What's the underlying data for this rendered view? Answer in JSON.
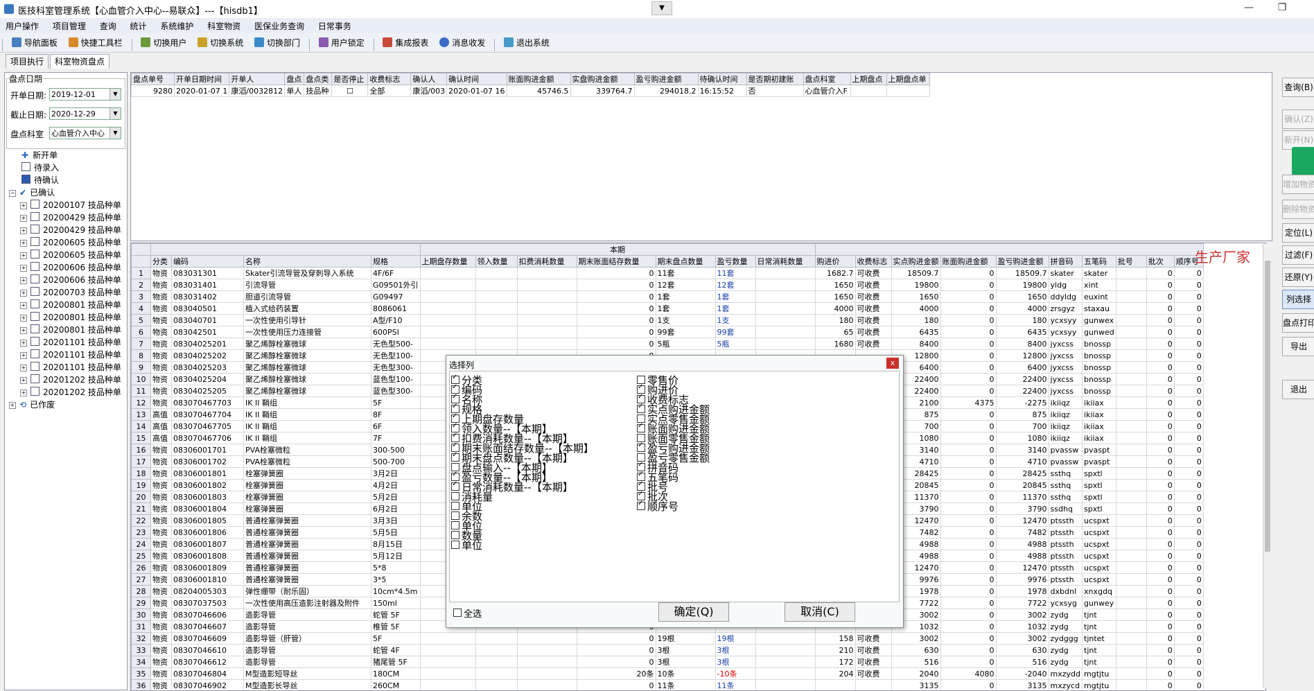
{
  "window": {
    "title": "医技科室管理系统【心血管介入中心--易联众】---【hisdb1】",
    "minimize": "—",
    "restore": "❐",
    "close": "✕"
  },
  "menu": [
    "用户操作",
    "项目管理",
    "查询",
    "统计",
    "系统维护",
    "科室物资",
    "医保业务查询",
    "日常事务"
  ],
  "toolbar": [
    "导航面板",
    "快捷工具栏",
    "切换用户",
    "切换系统",
    "切换部门",
    "用户锁定",
    "集成报表",
    "消息收发",
    "退出系统"
  ],
  "tabs": [
    "项目执行",
    "科室物资盘点"
  ],
  "left": {
    "group_title": "盘点日期",
    "start_label": "开单日期:",
    "start_value": "2019-12-01",
    "end_label": "截止日期:",
    "end_value": "2020-12-29",
    "dept_label": "盘点科室",
    "dept_value": "心血管介入中心",
    "tree": {
      "new": "新开单",
      "pending_entry": "待录入",
      "pending_confirm": "待确认",
      "confirmed": "已确认",
      "voided": "已作废",
      "children": [
        "20200107 技品种单",
        "20200429 技品种单",
        "20200429 技品种单",
        "20200605 技品种单",
        "20200605 技品种单",
        "20200606 技品种单",
        "20200606 技品种单",
        "20200703 技品种单",
        "20200801 技品种单",
        "20200801 技品种单",
        "20200801 技品种单",
        "20201101 技品种单",
        "20201101 技品种单",
        "20201101 技品种单",
        "20201202 技品种单",
        "20201202 技品种单"
      ]
    }
  },
  "top_grid": {
    "headers": [
      "盘点单号",
      "开单日期时间",
      "开单人",
      "盘点",
      "盘点类",
      "是否停止",
      "收费标志",
      "确认人",
      "确认时间",
      "账面购进金额",
      "实盘购进金额",
      "盈亏购进金额",
      "待确认时间",
      "是否期初建账",
      "盘点科室",
      "上期盘点",
      "上期盘点单"
    ],
    "row": [
      "9280",
      "2020-01-07 1",
      "康滔/0032812",
      "单人",
      "技品种",
      "☐",
      "全部",
      "康滔/003",
      "2020-01-07 16",
      "45746.5",
      "339764.7",
      "294018.2",
      "16:15:52",
      "否",
      "心血管介入F",
      "",
      ""
    ]
  },
  "bottom_grid": {
    "group_header": "本期",
    "headers": [
      "分类",
      "编码",
      "名称",
      "规格",
      "上期盘存数量",
      "领入数量",
      "扣费消耗数量",
      "期末账面结存数量",
      "期末盘点数量",
      "盈亏数量",
      "日常消耗数量",
      "购进价",
      "收费标志",
      "实点购进金额",
      "账面购进金额",
      "盈亏购进金额",
      "拼音码",
      "五笔码",
      "批号",
      "批次",
      "顺序号"
    ],
    "rows": [
      [
        "1",
        "物资",
        "083031301",
        "Skater引流导管及穿刺导入系统",
        "4F/6F",
        "",
        "",
        "",
        "0",
        "11套",
        "11套",
        "",
        "1682.7",
        "可收费",
        "18509.7",
        "0",
        "18509.7",
        "skater",
        "skater",
        "",
        "0",
        "0"
      ],
      [
        "2",
        "物资",
        "083031401",
        "引流导管",
        "G09501外引",
        "",
        "",
        "",
        "0",
        "12套",
        "12套",
        "",
        "1650",
        "可收费",
        "19800",
        "0",
        "19800",
        "yldg",
        "xint",
        "",
        "0",
        "0"
      ],
      [
        "3",
        "物资",
        "083031402",
        "胆道引流导管",
        "G09497",
        "",
        "",
        "",
        "0",
        "1套",
        "1套",
        "",
        "1650",
        "可收费",
        "1650",
        "0",
        "1650",
        "ddyldg",
        "euxint",
        "",
        "0",
        "0"
      ],
      [
        "4",
        "物资",
        "083040501",
        "植入式给药装置",
        "8086061",
        "",
        "",
        "",
        "0",
        "1套",
        "1套",
        "",
        "4000",
        "可收费",
        "4000",
        "0",
        "4000",
        "zrsgyz",
        "staxau",
        "",
        "0",
        "0"
      ],
      [
        "5",
        "物资",
        "083040701",
        "一次性使用引导针",
        "A型/F10",
        "",
        "",
        "",
        "0",
        "1支",
        "1支",
        "",
        "180",
        "可收费",
        "180",
        "0",
        "180",
        "ycxsyy",
        "gunwex",
        "",
        "0",
        "0"
      ],
      [
        "6",
        "物资",
        "083042501",
        "一次性使用压力连接管",
        "600PSI",
        "",
        "",
        "",
        "0",
        "99套",
        "99套",
        "",
        "65",
        "可收费",
        "6435",
        "0",
        "6435",
        "ycxsyy",
        "gunwed",
        "",
        "0",
        "0"
      ],
      [
        "7",
        "物资",
        "08304025201",
        "聚乙烯醇栓塞微球",
        "无色型500-",
        "",
        "",
        "",
        "0",
        "5瓶",
        "5瓶",
        "",
        "1680",
        "可收费",
        "8400",
        "0",
        "8400",
        "jyxcss",
        "bnossp",
        "",
        "0",
        "0"
      ],
      [
        "8",
        "物资",
        "08304025202",
        "聚乙烯醇栓塞微球",
        "无色型100-",
        "",
        "",
        "",
        "0",
        "",
        "",
        "",
        "",
        "",
        "12800",
        "0",
        "12800",
        "jyxcss",
        "bnossp",
        "",
        "0",
        "0"
      ],
      [
        "9",
        "物资",
        "08304025203",
        "聚乙烯醇栓塞微球",
        "无色型300-",
        "",
        "",
        "",
        "0",
        "",
        "",
        "",
        "",
        "",
        "6400",
        "0",
        "6400",
        "jyxcss",
        "bnossp",
        "",
        "0",
        "0"
      ],
      [
        "10",
        "物资",
        "08304025204",
        "聚乙烯醇栓塞微球",
        "蓝色型100-",
        "",
        "",
        "",
        "0",
        "",
        "",
        "",
        "",
        "",
        "22400",
        "0",
        "22400",
        "jyxcss",
        "bnossp",
        "",
        "0",
        "0"
      ],
      [
        "11",
        "物资",
        "08304025205",
        "聚乙烯醇栓塞微球",
        "蓝色型300-",
        "",
        "",
        "",
        "0",
        "",
        "",
        "",
        "",
        "",
        "22400",
        "0",
        "22400",
        "jyxcss",
        "bnossp",
        "",
        "0",
        "0"
      ],
      [
        "12",
        "物资",
        "083070467703",
        "IK II 鞘组",
        "5F",
        "",
        "",
        "",
        "0",
        "",
        "",
        "",
        "",
        "",
        "2100",
        "4375",
        "-2275",
        "ikiiqz",
        "ikiiax",
        "",
        "0",
        "0"
      ],
      [
        "13",
        "高值",
        "083070467704",
        "IK II 鞘组",
        "8F",
        "",
        "",
        "",
        "0",
        "",
        "",
        "",
        "",
        "",
        "875",
        "0",
        "875",
        "ikiiqz",
        "ikiiax",
        "",
        "0",
        "0"
      ],
      [
        "14",
        "高值",
        "083070467705",
        "IK II 鞘组",
        "6F",
        "",
        "",
        "",
        "0",
        "",
        "",
        "",
        "",
        "",
        "700",
        "0",
        "700",
        "ikiiqz",
        "ikiiax",
        "",
        "0",
        "0"
      ],
      [
        "15",
        "高值",
        "083070467706",
        "IK II 鞘组",
        "7F",
        "",
        "",
        "",
        "0",
        "",
        "",
        "",
        "",
        "",
        "1080",
        "0",
        "1080",
        "ikiiqz",
        "ikiiax",
        "",
        "0",
        "0"
      ],
      [
        "16",
        "物资",
        "08306001701",
        "PVA栓塞微粒",
        "300-500",
        "",
        "",
        "",
        "0",
        "",
        "",
        "",
        "",
        "",
        "3140",
        "0",
        "3140",
        "pvassw",
        "pvaspt",
        "",
        "0",
        "0"
      ],
      [
        "17",
        "物资",
        "08306001702",
        "PVA栓塞微粒",
        "500-700",
        "",
        "",
        "",
        "0",
        "",
        "",
        "",
        "",
        "",
        "4710",
        "0",
        "4710",
        "pvassw",
        "pvaspt",
        "",
        "0",
        "0"
      ],
      [
        "18",
        "物资",
        "08306001801",
        "栓塞弹簧圈",
        "3月2日",
        "",
        "",
        "",
        "0",
        "",
        "",
        "",
        "",
        "",
        "28425",
        "0",
        "28425",
        "ssthq",
        "spxtl",
        "",
        "0",
        "0"
      ],
      [
        "19",
        "物资",
        "08306001802",
        "栓塞弹簧圈",
        "4月2日",
        "",
        "",
        "",
        "0",
        "",
        "",
        "",
        "",
        "",
        "20845",
        "0",
        "20845",
        "ssthq",
        "spxtl",
        "",
        "0",
        "0"
      ],
      [
        "20",
        "物资",
        "08306001803",
        "栓塞弹簧圈",
        "5月2日",
        "",
        "",
        "",
        "0",
        "",
        "",
        "",
        "",
        "",
        "11370",
        "0",
        "11370",
        "ssthq",
        "spxtl",
        "",
        "0",
        "0"
      ],
      [
        "21",
        "物资",
        "08306001804",
        "栓塞弹簧圈",
        "6月2日",
        "",
        "",
        "",
        "0",
        "",
        "",
        "",
        "",
        "",
        "3790",
        "0",
        "3790",
        "ssdhq",
        "spxtl",
        "",
        "0",
        "0"
      ],
      [
        "22",
        "物资",
        "08306001805",
        "普通栓塞弹簧圈",
        "3月3日",
        "",
        "",
        "",
        "0",
        "",
        "",
        "",
        "",
        "",
        "12470",
        "0",
        "12470",
        "ptssth",
        "ucspxt",
        "",
        "0",
        "0"
      ],
      [
        "23",
        "物资",
        "08306001806",
        "普通栓塞弹簧圈",
        "5月5日",
        "",
        "",
        "",
        "0",
        "",
        "",
        "",
        "",
        "",
        "7482",
        "0",
        "7482",
        "ptssth",
        "ucspxt",
        "",
        "0",
        "0"
      ],
      [
        "24",
        "物资",
        "08306001807",
        "普通栓塞弹簧圈",
        "8月15日",
        "",
        "",
        "",
        "0",
        "",
        "",
        "",
        "",
        "",
        "4988",
        "0",
        "4988",
        "ptssth",
        "ucspxt",
        "",
        "0",
        "0"
      ],
      [
        "25",
        "物资",
        "08306001808",
        "普通栓塞弹簧圈",
        "5月12日",
        "",
        "",
        "",
        "0",
        "",
        "",
        "",
        "",
        "",
        "4988",
        "0",
        "4988",
        "ptssth",
        "ucspxt",
        "",
        "0",
        "0"
      ],
      [
        "26",
        "物资",
        "08306001809",
        "普通栓塞弹簧圈",
        "5*8",
        "",
        "",
        "",
        "0",
        "",
        "",
        "",
        "",
        "",
        "12470",
        "0",
        "12470",
        "ptssth",
        "ucspxt",
        "",
        "0",
        "0"
      ],
      [
        "27",
        "物资",
        "08306001810",
        "普通栓塞弹簧圈",
        "3*5",
        "",
        "",
        "",
        "0",
        "",
        "",
        "",
        "",
        "",
        "9976",
        "0",
        "9976",
        "ptssth",
        "ucspxt",
        "",
        "0",
        "0"
      ],
      [
        "28",
        "物资",
        "08204005303",
        "弹性绷带（耐乐固）",
        "10cm*4.5m",
        "",
        "",
        "",
        "0",
        "",
        "",
        "",
        "",
        "",
        "1978",
        "0",
        "1978",
        "dxbdnl",
        "xnxgdq",
        "",
        "0",
        "0"
      ],
      [
        "29",
        "物资",
        "08307037503",
        "一次性使用高压造影注射器及附件",
        "150ml",
        "",
        "",
        "",
        "0",
        "",
        "",
        "",
        "",
        "",
        "7722",
        "0",
        "7722",
        "ycxsyg",
        "gunwey",
        "",
        "0",
        "0"
      ],
      [
        "30",
        "物资",
        "08307046606",
        "造影导管",
        "蛇管 5F",
        "",
        "",
        "",
        "0",
        "",
        "",
        "",
        "",
        "",
        "3002",
        "0",
        "3002",
        "zydg",
        "tjnt",
        "",
        "0",
        "0"
      ],
      [
        "31",
        "物资",
        "08307046607",
        "造影导管",
        "椎管 5F",
        "",
        "",
        "",
        "0",
        "",
        "",
        "",
        "",
        "",
        "1032",
        "0",
        "1032",
        "zydg",
        "tjnt",
        "",
        "0",
        "0"
      ],
      [
        "32",
        "物资",
        "08307046609",
        "造影导管（肝管）",
        "5F",
        "",
        "",
        "",
        "0",
        "19根",
        "19根",
        "",
        "158",
        "可收费",
        "3002",
        "0",
        "3002",
        "zydggg",
        "tjntet",
        "",
        "0",
        "0"
      ],
      [
        "33",
        "物资",
        "08307046610",
        "造影导管",
        "蛇管 4F",
        "",
        "",
        "",
        "0",
        "3根",
        "3根",
        "",
        "210",
        "可收费",
        "630",
        "0",
        "630",
        "zydg",
        "tjnt",
        "",
        "0",
        "0"
      ],
      [
        "34",
        "物资",
        "08307046612",
        "造影导管",
        "猪尾管 5F",
        "",
        "",
        "",
        "0",
        "3根",
        "3根",
        "",
        "172",
        "可收费",
        "516",
        "0",
        "516",
        "zydg",
        "tjnt",
        "",
        "0",
        "0"
      ],
      [
        "35",
        "物资",
        "08307046804",
        "M型造影短导丝",
        "180CM",
        "",
        "",
        "",
        "20条",
        "10条",
        "-10条",
        "",
        "204",
        "可收费",
        "2040",
        "4080",
        "-2040",
        "mxzydd",
        "mgtjtu",
        "",
        "0",
        "0"
      ],
      [
        "36",
        "物资",
        "08307046902",
        "M型造影长导丝",
        "260CM",
        "",
        "",
        "",
        "0",
        "11条",
        "11条",
        "",
        "",
        "",
        "3135",
        "0",
        "3135",
        "mxzycd",
        "mgtjtu",
        "",
        "0",
        "0"
      ]
    ]
  },
  "producer_label": "生产厂家",
  "right_buttons": [
    "查询(B)",
    "确认(Z)",
    "新开(N)",
    "增加物资",
    "删除物资",
    "定位(L)",
    "过滤(F)",
    "还原(Y)",
    "列选择",
    "盘点打印",
    "导出",
    "退出"
  ],
  "dialog": {
    "title": "选择列",
    "close": "x",
    "left_items": [
      {
        "label": "分类",
        "checked": true
      },
      {
        "label": "编码",
        "checked": true
      },
      {
        "label": "名称",
        "checked": true
      },
      {
        "label": "规格",
        "checked": true
      },
      {
        "label": "上期盘存数量",
        "checked": true
      },
      {
        "label": "领入数量--【本期】",
        "checked": true
      },
      {
        "label": "扣费消耗数量--【本期】",
        "checked": true
      },
      {
        "label": "期末账面结存数量--【本期】",
        "checked": true
      },
      {
        "label": "期末盘点数量--【本期】",
        "checked": true
      },
      {
        "label": "盘点输入--【本期】",
        "checked": false
      },
      {
        "label": "盈亏数量--【本期】",
        "checked": true
      },
      {
        "label": "日常消耗数量--【本期】",
        "checked": true
      },
      {
        "label": "消耗量",
        "checked": false
      },
      {
        "label": "单位",
        "checked": false
      },
      {
        "label": "余数",
        "checked": false
      },
      {
        "label": "单位",
        "checked": false
      },
      {
        "label": "数量",
        "checked": false
      },
      {
        "label": "单位",
        "checked": false
      }
    ],
    "right_items": [
      {
        "label": "零售价",
        "checked": false
      },
      {
        "label": "购进价",
        "checked": true
      },
      {
        "label": "收费标志",
        "checked": true
      },
      {
        "label": "实点购进金额",
        "checked": true
      },
      {
        "label": "实点零售金额",
        "checked": false
      },
      {
        "label": "账面购进金额",
        "checked": true
      },
      {
        "label": "账面零售金额",
        "checked": false
      },
      {
        "label": "盈亏购进金额",
        "checked": true
      },
      {
        "label": "盈亏零售金额",
        "checked": false
      },
      {
        "label": "拼音码",
        "checked": true
      },
      {
        "label": "五笔码",
        "checked": true
      },
      {
        "label": "批号",
        "checked": true
      },
      {
        "label": "批次",
        "checked": true
      },
      {
        "label": "顺序号",
        "checked": true
      }
    ],
    "select_all": "全选",
    "ok": "确定(Q)",
    "cancel": "取消(C)"
  }
}
